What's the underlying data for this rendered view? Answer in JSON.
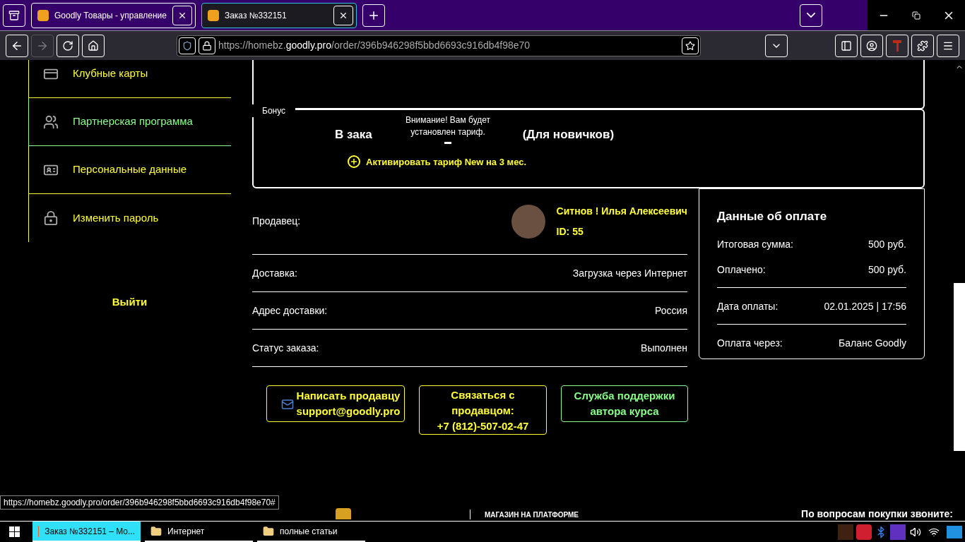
{
  "browser": {
    "tabs": [
      {
        "title": "Goodly Товары - управление",
        "selected": false
      },
      {
        "title": "Заказ №332151",
        "selected": true
      }
    ],
    "url_host_prefix": "https://homebz.",
    "url_host": "goodly.pro",
    "url_path": "/order/396b946298f5bbd6693c916db4f98e70",
    "forward_disabled": true
  },
  "sidebar": {
    "items": [
      {
        "label": "Клубные карты",
        "selected": false
      },
      {
        "label": "Партнерская программа",
        "selected": true
      },
      {
        "label": "Персональные данные",
        "selected": false
      },
      {
        "label": "Изменить пароль",
        "selected": false
      }
    ],
    "logout": "Выйти"
  },
  "bonus": {
    "legend": "Бонус",
    "heading_start": "В зака",
    "heading_end": "(Для новичков)",
    "tooltip": "Внимание! Вам будет установлен тариф.",
    "action": "Активировать тариф New на 3 мес."
  },
  "order": {
    "seller_label": "Продавец:",
    "seller_name": "Ситнов ! Илья Алексеевич",
    "seller_id": "ID: 55",
    "rows": [
      {
        "label": "Доставка:",
        "value": "Загрузка через Интернет"
      },
      {
        "label": "Адрес доставки:",
        "value": "Россия"
      },
      {
        "label": "Статус заказа:",
        "value": "Выполнен"
      }
    ]
  },
  "payment": {
    "title": "Данные об оплате",
    "rows": [
      {
        "label": "Итоговая сумма:",
        "value": "500 руб."
      },
      {
        "label": "Оплачено:",
        "value": "500 руб."
      },
      {
        "label": "Дата оплаты:",
        "value": "02.01.2025 | 17:56"
      },
      {
        "label": "Оплата через:",
        "value": "Баланс Goodly"
      }
    ]
  },
  "buttons": [
    {
      "kind": "email",
      "lines": [
        "Написать продавцу",
        "support@goodly.pro"
      ],
      "color": "#ffff33"
    },
    {
      "kind": "phone",
      "lines": [
        "Связаться с продавцом:",
        "+7 (812)-507-02-47"
      ],
      "color": "#ffff33"
    },
    {
      "kind": "support",
      "lines": [
        "Служба поддержки автора курса"
      ],
      "color": "#88ff88"
    }
  ],
  "footer": {
    "platform": "МАГАЗИН НА ПЛАТФОРМЕ",
    "phone_prompt": "По вопросам покупки звоните:"
  },
  "status_url": "https://homebz.goodly.pro/order/396b946298f5bbd6693c916db4f98e70#",
  "taskbar": {
    "items": [
      {
        "label": "Заказ №332151 – Mo...",
        "kind": "browser",
        "selected": true
      },
      {
        "label": "Интернет",
        "kind": "folder",
        "selected": false
      },
      {
        "label": "полные статьи",
        "kind": "folder",
        "selected": false
      }
    ]
  }
}
